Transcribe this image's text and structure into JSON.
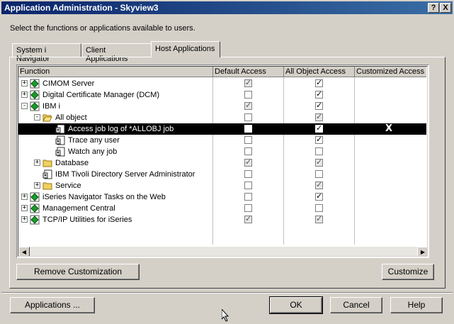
{
  "window": {
    "title": "Application Administration - Skyview3",
    "help_button": "?",
    "close_button": "X"
  },
  "instruction": "Select the functions or applications available to users.",
  "tabs": [
    {
      "label": "System i Navigator",
      "active": false
    },
    {
      "label": "Client Applications",
      "active": false
    },
    {
      "label": "Host Applications",
      "active": true
    }
  ],
  "table": {
    "columns": [
      "Function",
      "Default Access",
      "All Object Access",
      "Customized Access"
    ],
    "rows": [
      {
        "name": "CIMOM Server",
        "level": 0,
        "expander": "+",
        "icon": "app-icon",
        "default": "checked-grey",
        "allobj": "checked",
        "custom": ""
      },
      {
        "name": "Digital Certificate Manager (DCM)",
        "level": 0,
        "expander": "+",
        "icon": "app-icon",
        "default": "unchecked",
        "allobj": "checked",
        "custom": ""
      },
      {
        "name": "IBM i",
        "level": 0,
        "expander": "-",
        "icon": "app-icon",
        "default": "checked-grey",
        "allobj": "checked",
        "custom": ""
      },
      {
        "name": "All object",
        "level": 1,
        "expander": "-",
        "icon": "folder-open-icon",
        "default": "unchecked",
        "allobj": "checked-grey",
        "custom": ""
      },
      {
        "name": "Access job log of *ALLOBJ job",
        "level": 2,
        "expander": "",
        "icon": "function-icon",
        "default": "unchecked",
        "allobj": "checked",
        "custom": "X",
        "selected": true
      },
      {
        "name": "Trace any user",
        "level": 2,
        "expander": "",
        "icon": "function-icon",
        "default": "unchecked",
        "allobj": "checked",
        "custom": ""
      },
      {
        "name": "Watch any job",
        "level": 2,
        "expander": "",
        "icon": "function-icon",
        "default": "unchecked",
        "allobj": "unchecked",
        "custom": ""
      },
      {
        "name": "Database",
        "level": 1,
        "expander": "+",
        "icon": "folder-icon",
        "default": "checked-grey",
        "allobj": "checked-grey",
        "custom": ""
      },
      {
        "name": "IBM Tivoli Directory Server Administrator",
        "level": 1,
        "expander": "",
        "icon": "function-icon",
        "default": "unchecked",
        "allobj": "unchecked",
        "custom": ""
      },
      {
        "name": "Service",
        "level": 1,
        "expander": "+",
        "icon": "folder-icon",
        "default": "unchecked",
        "allobj": "checked-grey",
        "custom": ""
      },
      {
        "name": "iSeries Navigator Tasks on the Web",
        "level": 0,
        "expander": "+",
        "icon": "app-icon",
        "default": "unchecked",
        "allobj": "checked",
        "custom": ""
      },
      {
        "name": "Management Central",
        "level": 0,
        "expander": "+",
        "icon": "app-icon",
        "default": "unchecked",
        "allobj": "unchecked",
        "custom": ""
      },
      {
        "name": "TCP/IP Utilities for iSeries",
        "level": 0,
        "expander": "+",
        "icon": "app-icon",
        "default": "checked-grey",
        "allobj": "checked-grey",
        "custom": ""
      }
    ]
  },
  "buttons": {
    "remove_customization": "Remove Customization",
    "customize": "Customize",
    "applications": "Applications ...",
    "ok": "OK",
    "cancel": "Cancel",
    "help": "Help"
  },
  "colors": {
    "title_start": "#0a246a",
    "title_end": "#3a6ea5",
    "dialog_bg": "#d4d0c8",
    "selection": "#000000"
  }
}
